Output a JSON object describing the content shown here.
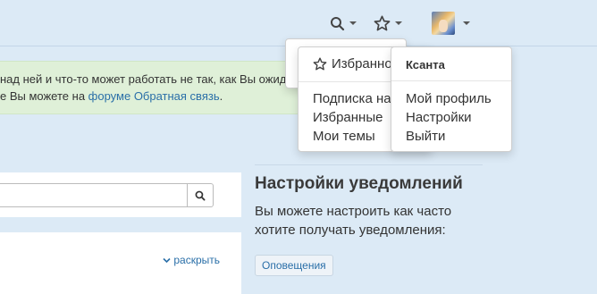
{
  "notice": {
    "line1": "над ней и что-то может работать не так, как Вы ожид",
    "line2_prefix": "е Вы можете на ",
    "link1": "форуме",
    "link_space": " ",
    "link2": "Обратная связь",
    "line2_suffix": "."
  },
  "search": {
    "placeholder": ""
  },
  "list": {
    "expand_label": "раскрыть"
  },
  "settings": {
    "title": "Настройки уведомлений",
    "description": "Вы можете настроить как часто хотите получать уведомления:",
    "notifications_button": "Оповещения"
  },
  "favorites_menu": {
    "header": "Избранное",
    "items": [
      "Подписка на",
      "Избранные",
      "Мои темы"
    ]
  },
  "user_menu": {
    "username": "Ксанта",
    "items": [
      "Мой профиль",
      "Настройки",
      "Выйти"
    ]
  },
  "icons": {
    "search": "search-icon",
    "star": "star-icon",
    "caret": "chevron-down-icon"
  },
  "colors": {
    "background": "#dceaf6",
    "notice_bg": "#dff0d8",
    "link": "#2a6fa8"
  }
}
